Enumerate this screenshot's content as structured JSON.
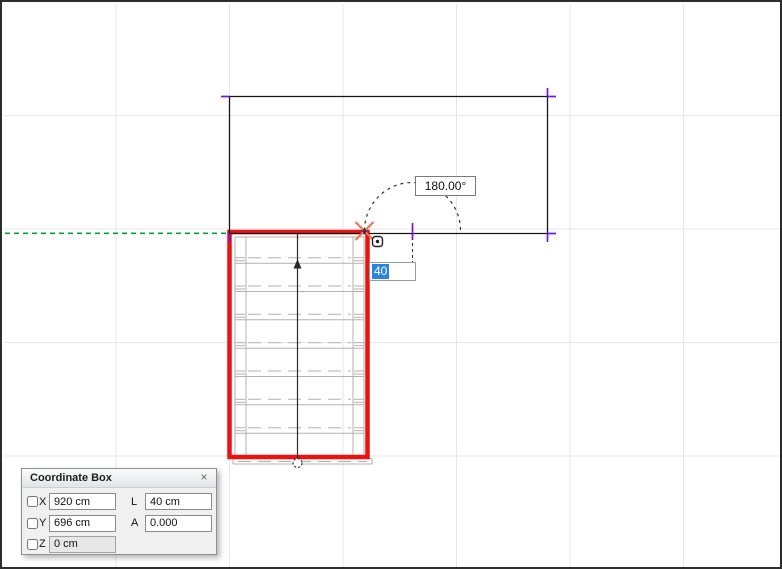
{
  "window": {
    "background": "#ffffff",
    "border_color": "#2d2d2d",
    "grid_color": "#e6e6ef"
  },
  "canvas": {
    "angle_readout": "180.00°",
    "tracker": {
      "value": "40",
      "selection_bg": "#2a83e0"
    },
    "colors": {
      "selection_red": "#ee1111",
      "guide_green": "#00a43b",
      "hotspot_purple": "#7a10e8",
      "cursor_orange": "#e87a50",
      "stair_gray": "#b2b2b2",
      "line_black": "#161616"
    },
    "elements": {
      "rectangle_outline": "drawn rectangle with purple hotspots",
      "stair_symbol": "selected stair with red highlight",
      "guide_line": "green dashed guide line",
      "angle_arc": "dashed 180-degree arc"
    }
  },
  "coordinate_box": {
    "title": "Coordinate Box",
    "close_label": "×",
    "rows": [
      {
        "label": "X",
        "value": "920 cm"
      },
      {
        "label": "Y",
        "value": "696 cm"
      },
      {
        "label": "Z",
        "value": "0 cm"
      }
    ],
    "side": [
      {
        "label": "L",
        "value": "40 cm"
      },
      {
        "label": "A",
        "value": "0.000"
      }
    ]
  }
}
